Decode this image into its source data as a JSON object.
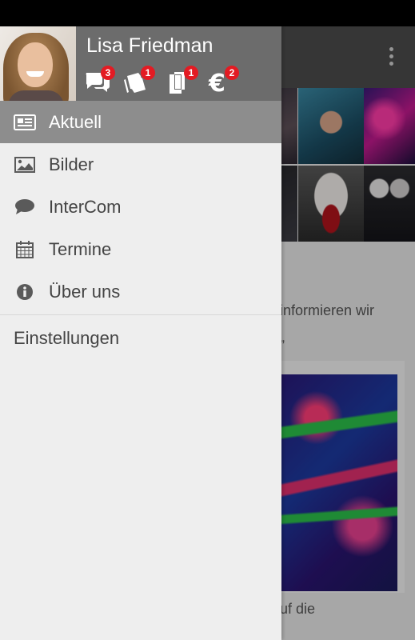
{
  "user": {
    "name": "Lisa Friedman"
  },
  "badges": [
    {
      "icon": "chat-bubbles-icon",
      "count": "3"
    },
    {
      "icon": "tickets-icon",
      "count": "1"
    },
    {
      "icon": "documents-icon",
      "count": "1"
    },
    {
      "icon": "euro-icon",
      "count": "2"
    }
  ],
  "menu": {
    "items": [
      {
        "label": "Aktuell",
        "icon": "newspaper-icon",
        "active": true
      },
      {
        "label": "Bilder",
        "icon": "image-icon",
        "active": false
      },
      {
        "label": "InterCom",
        "icon": "speech-bubble-icon",
        "active": false
      },
      {
        "label": "Termine",
        "icon": "calendar-icon",
        "active": false
      },
      {
        "label": "Über uns",
        "icon": "info-icon",
        "active": false
      }
    ],
    "settings_label": "Einstellungen"
  },
  "background": {
    "text_line1": "informieren wir",
    "text_line2": "„",
    "text_line3": "uf die"
  },
  "colors": {
    "header_bg": "#6c6c6c",
    "active_item_bg": "#8d8d8d",
    "badge": "#e31b23",
    "drawer_bg": "#eeeeee"
  }
}
